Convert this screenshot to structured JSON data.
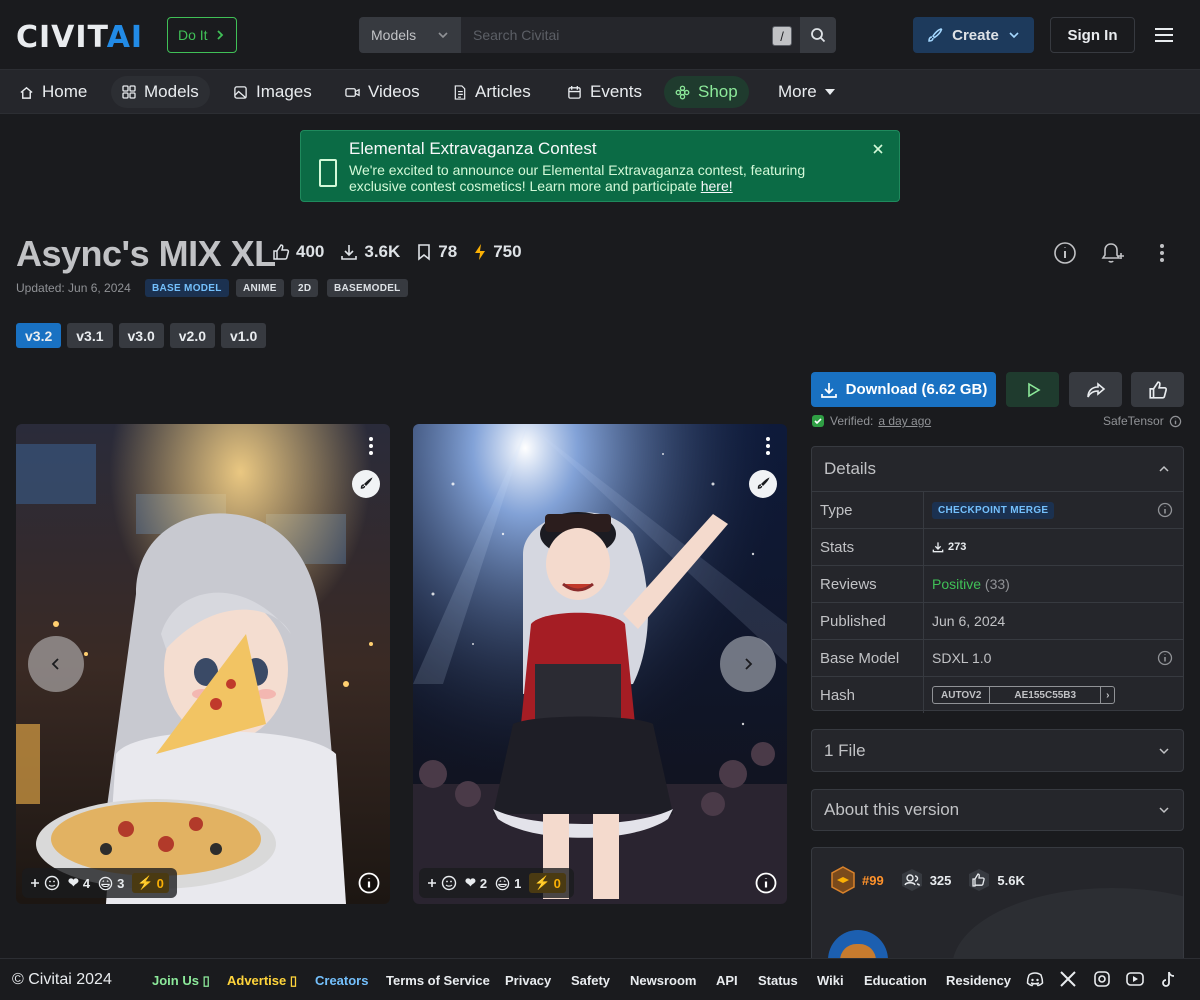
{
  "header": {
    "logo_main": "CIVIT",
    "logo_ai": "AI",
    "doit_label": "Do It",
    "search_type": "Models",
    "search_placeholder": "Search Civitai",
    "search_shortcut": "/",
    "create_label": "Create",
    "signin_label": "Sign In"
  },
  "nav": {
    "items": [
      {
        "label": "Home",
        "icon": "home-icon"
      },
      {
        "label": "Models",
        "icon": "grid-icon"
      },
      {
        "label": "Images",
        "icon": "image-icon"
      },
      {
        "label": "Videos",
        "icon": "video-icon"
      },
      {
        "label": "Articles",
        "icon": "article-icon"
      },
      {
        "label": "Events",
        "icon": "calendar-icon"
      },
      {
        "label": "Shop",
        "icon": "shop-icon"
      },
      {
        "label": "More",
        "icon": "caret-down-icon"
      }
    ]
  },
  "announcement": {
    "title": "Elemental Extravaganza Contest",
    "body": "We're excited to announce our Elemental Extravaganza contest, featuring exclusive contest cosmetics! Learn more and participate",
    "link": "here!"
  },
  "model": {
    "title": "Async's MIX XL",
    "likes": "400",
    "downloads": "3.6K",
    "bookmarks": "78",
    "buzz": "750",
    "updated": "Updated: Jun 6, 2024",
    "badges": [
      "BASE MODEL",
      "ANIME",
      "2D",
      "BASEMODEL"
    ],
    "versions": [
      "v3.2",
      "v3.1",
      "v3.0",
      "v2.0",
      "v1.0"
    ]
  },
  "gallery": [
    {
      "hearts": "4",
      "laughs": "3",
      "buzz": "0"
    },
    {
      "hearts": "2",
      "laughs": "1",
      "buzz": "0"
    }
  ],
  "download": {
    "label": "Download (6.62 GB)",
    "verified_label": "Verified:",
    "verified_when": "a day ago",
    "format": "SafeTensor"
  },
  "details": {
    "heading": "Details",
    "rows": {
      "type_k": "Type",
      "type_v": "CHECKPOINT MERGE",
      "stats_k": "Stats",
      "stats_v": "273",
      "reviews_k": "Reviews",
      "reviews_v": "Positive",
      "reviews_count": "(33)",
      "published_k": "Published",
      "published_v": "Jun 6, 2024",
      "base_k": "Base Model",
      "base_v": "SDXL 1.0",
      "hash_k": "Hash",
      "hash_type": "AUTOV2",
      "hash_v": "AE155C55B3"
    }
  },
  "files_panel": {
    "heading": "1 File"
  },
  "about_panel": {
    "heading": "About this version"
  },
  "creator": {
    "rank": "#99",
    "followers": "325",
    "likes": "5.6K"
  },
  "footer": {
    "copyright": "© Civitai 2024",
    "links": [
      "Join Us",
      "Advertise",
      "Creators",
      "Terms of Service",
      "Privacy",
      "Safety",
      "Newsroom",
      "API",
      "Status",
      "Wiki",
      "Education",
      "Residency"
    ]
  },
  "colors": {
    "accent": "#1971c2",
    "success": "#40c057",
    "buzz": "#fab005",
    "announce_bg": "#0b6b45"
  }
}
